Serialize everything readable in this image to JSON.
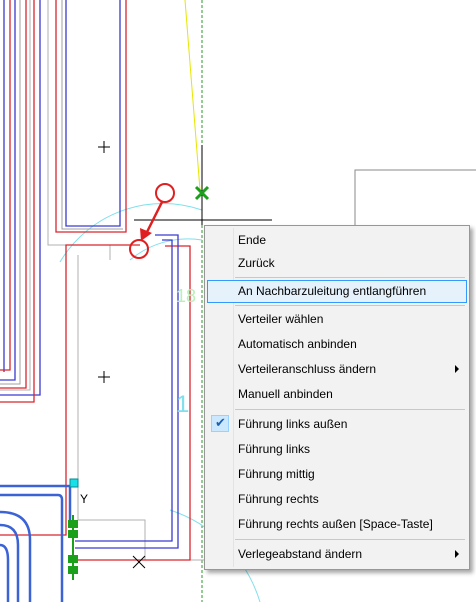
{
  "canvas": {
    "dim_label_a": "18",
    "dim_label_b": "1",
    "y_marker": "Y"
  },
  "context_menu": {
    "items": [
      {
        "label": "Ende"
      },
      {
        "label": "Zurück"
      },
      {
        "label": "An Nachbarzuleitung entlangführen",
        "highlighted": true
      },
      {
        "label": "Verteiler wählen"
      },
      {
        "label": "Automatisch anbinden"
      },
      {
        "label": "Verteileranschluss ändern",
        "submenu": true
      },
      {
        "label": "Manuell anbinden"
      },
      {
        "label": "Führung links außen",
        "checked": true
      },
      {
        "label": "Führung links"
      },
      {
        "label": "Führung mittig"
      },
      {
        "label": "Führung rechts"
      },
      {
        "label": "Führung rechts außen  [Space-Taste]"
      },
      {
        "label": "Verlegeabstand ändern",
        "submenu": true
      }
    ]
  },
  "colors": {
    "red_pipe": "#d9262e",
    "blue_pipe": "#3a3ad0",
    "cyan": "#7fe0ec",
    "green": "#1aa01a",
    "highlight_bg": "#e5f1fb",
    "highlight_border": "#3399ff"
  },
  "icons": [
    "checkmark-icon",
    "submenu-arrow-icon",
    "cross-marker-icon"
  ]
}
